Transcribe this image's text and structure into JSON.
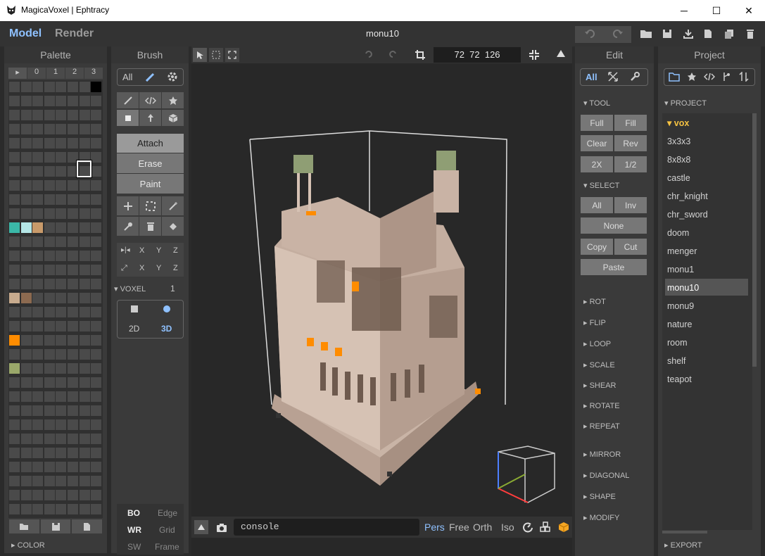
{
  "window": {
    "title": "MagicaVoxel | Ephtracy",
    "minimize": "─",
    "maximize": "☐",
    "close": "✕"
  },
  "menu": {
    "model": "Model",
    "render": "Render",
    "doc": "monu10"
  },
  "palette": {
    "title": "Palette",
    "tabs": [
      "▸",
      "0",
      "1",
      "2",
      "3"
    ],
    "footer": "COLOR",
    "colors": {
      "teal": "#3bb8a8",
      "cyan": "#b5e6e6",
      "tan": "#c89a6a",
      "beige": "#c8ab8e",
      "brown": "#8c6a50",
      "orange": "#ff8c00",
      "olive": "#9aa86a",
      "black": "#000000"
    }
  },
  "brush": {
    "title": "Brush",
    "all": "All",
    "modes": [
      "Attach",
      "Erase",
      "Paint"
    ],
    "axis_rows": [
      [
        "X",
        "Y",
        "Z"
      ],
      [
        "X",
        "Y",
        "Z"
      ]
    ],
    "voxel_label": "VOXEL",
    "voxel_value": "1",
    "dim2": "2D",
    "dim3": "3D",
    "display": [
      [
        "BO",
        "Edge"
      ],
      [
        "WR",
        "Grid"
      ],
      [
        "SW",
        "Frame"
      ]
    ]
  },
  "viewport": {
    "dims": "72  72  126",
    "console": "console",
    "views": [
      "Pers",
      "Free",
      "Orth",
      "Iso"
    ]
  },
  "edit": {
    "title": "Edit",
    "all": "All",
    "tool_label": "TOOL",
    "tool_buttons": [
      [
        "Full",
        "Fill"
      ],
      [
        "Clear",
        "Rev"
      ],
      [
        "2X",
        "1/2"
      ]
    ],
    "select_label": "SELECT",
    "select_buttons": [
      [
        "All",
        "Inv"
      ],
      [
        "None"
      ],
      [
        "Copy",
        "Cut"
      ],
      [
        "Paste"
      ]
    ],
    "groups": [
      "ROT",
      "FLIP",
      "LOOP",
      "SCALE",
      "SHEAR",
      "ROTATE",
      "REPEAT"
    ],
    "groups2": [
      "MIRROR",
      "DIAGONAL",
      "SHAPE",
      "MODIFY"
    ]
  },
  "project": {
    "title": "Project",
    "section": "PROJECT",
    "folder": "vox",
    "items": [
      "3x3x3",
      "8x8x8",
      "castle",
      "chr_knight",
      "chr_sword",
      "doom",
      "menger",
      "monu1",
      "monu10",
      "monu9",
      "nature",
      "room",
      "shelf",
      "teapot"
    ],
    "selected": "monu10",
    "footer": "EXPORT"
  }
}
